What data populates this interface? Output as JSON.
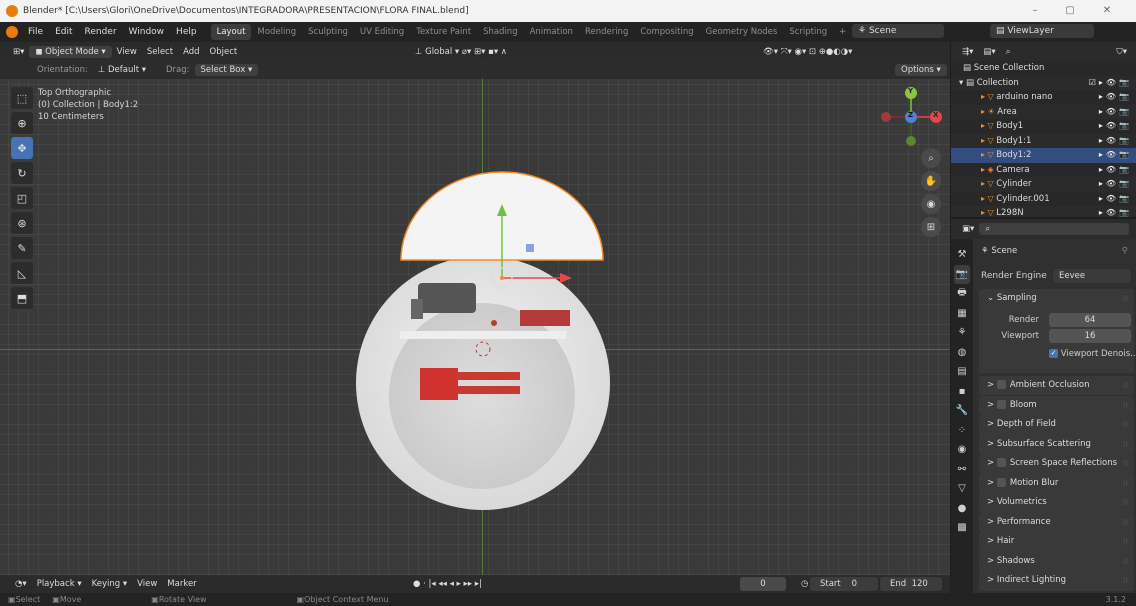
{
  "titlebar": {
    "title": "Blender* [C:\\Users\\Glori\\OneDrive\\Documentos\\INTEGRADORA\\PRESENTACION\\FLORA FINAL.blend]",
    "minimize": "–",
    "maximize": "▢",
    "close": "✕"
  },
  "menu": {
    "items": [
      "File",
      "Edit",
      "Render",
      "Window",
      "Help"
    ]
  },
  "workspaces": [
    "Layout",
    "Modeling",
    "Sculpting",
    "UV Editing",
    "Texture Paint",
    "Shading",
    "Animation",
    "Rendering",
    "Compositing",
    "Geometry Nodes",
    "Scripting",
    "+"
  ],
  "scene": {
    "label": "Scene",
    "viewlayer": "ViewLayer"
  },
  "viewport_header": {
    "mode": "Object Mode",
    "view": "View",
    "select": "Select",
    "add": "Add",
    "object": "Object",
    "transform": "Global"
  },
  "tool_settings": {
    "orientation_label": "Orientation:",
    "orientation": "Default",
    "drag_label": "Drag:",
    "drag": "Select Box",
    "options": "Options"
  },
  "viewport": {
    "line1": "Top Orthographic",
    "line2": "(0) Collection | Body1:2",
    "line3": "10 Centimeters",
    "gizmo_y": "Y",
    "gizmo_z": "Z",
    "gizmo_x": "X"
  },
  "outliner": {
    "root": "Scene Collection",
    "rows": [
      {
        "name": "Collection",
        "icon": "collection-icon"
      },
      {
        "name": "arduino nano",
        "icon": "mesh-icon"
      },
      {
        "name": "Area",
        "icon": "light-icon"
      },
      {
        "name": "Body1",
        "icon": "mesh-icon"
      },
      {
        "name": "Body1:1",
        "icon": "mesh-icon"
      },
      {
        "name": "Body1:2",
        "icon": "mesh-icon"
      },
      {
        "name": "Camera",
        "icon": "camera-icon"
      },
      {
        "name": "Cylinder",
        "icon": "mesh-icon"
      },
      {
        "name": "Cylinder.001",
        "icon": "mesh-icon"
      },
      {
        "name": "L298N",
        "icon": "mesh-icon"
      }
    ]
  },
  "properties": {
    "scene_label": "Scene",
    "render_engine_label": "Render Engine",
    "render_engine": "Eevee",
    "sampling": {
      "title": "Sampling",
      "render_label": "Render",
      "render_value": "64",
      "viewport_label": "Viewport",
      "viewport_value": "16",
      "denoise": "Viewport Denois..."
    },
    "sections": [
      "Ambient Occlusion",
      "Bloom",
      "Depth of Field",
      "Subsurface Scattering",
      "Screen Space Reflections",
      "Motion Blur",
      "Volumetrics",
      "Performance",
      "Hair",
      "Shadows",
      "Indirect Lighting"
    ]
  },
  "timeline": {
    "playback": "Playback",
    "keying": "Keying",
    "view": "View",
    "marker": "Marker",
    "frame": "0",
    "start_label": "Start",
    "start": "0",
    "end_label": "End",
    "end": "120"
  },
  "statusbar": {
    "select": "Select",
    "move": "Move",
    "rotate": "Rotate View",
    "context": "Object Context Menu",
    "version": "3.1.2"
  },
  "colors": {
    "accent": "#4772b3",
    "selection": "#334d80",
    "active_outline": "#f28c28"
  }
}
